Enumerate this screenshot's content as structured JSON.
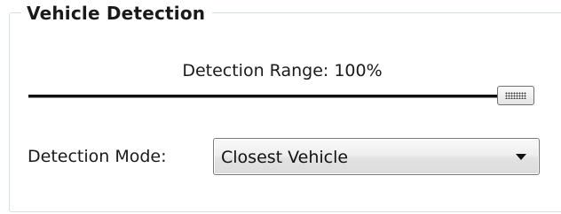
{
  "group": {
    "title": "Vehicle Detection"
  },
  "detection_range": {
    "label": "Detection Range:",
    "value_text": "100%",
    "value": 1.0
  },
  "detection_mode": {
    "label": "Detection Mode:",
    "selected": "Closest Vehicle"
  },
  "icons": {
    "slider_grip": "grip-icon",
    "dropdown": "chevron-down-icon"
  }
}
